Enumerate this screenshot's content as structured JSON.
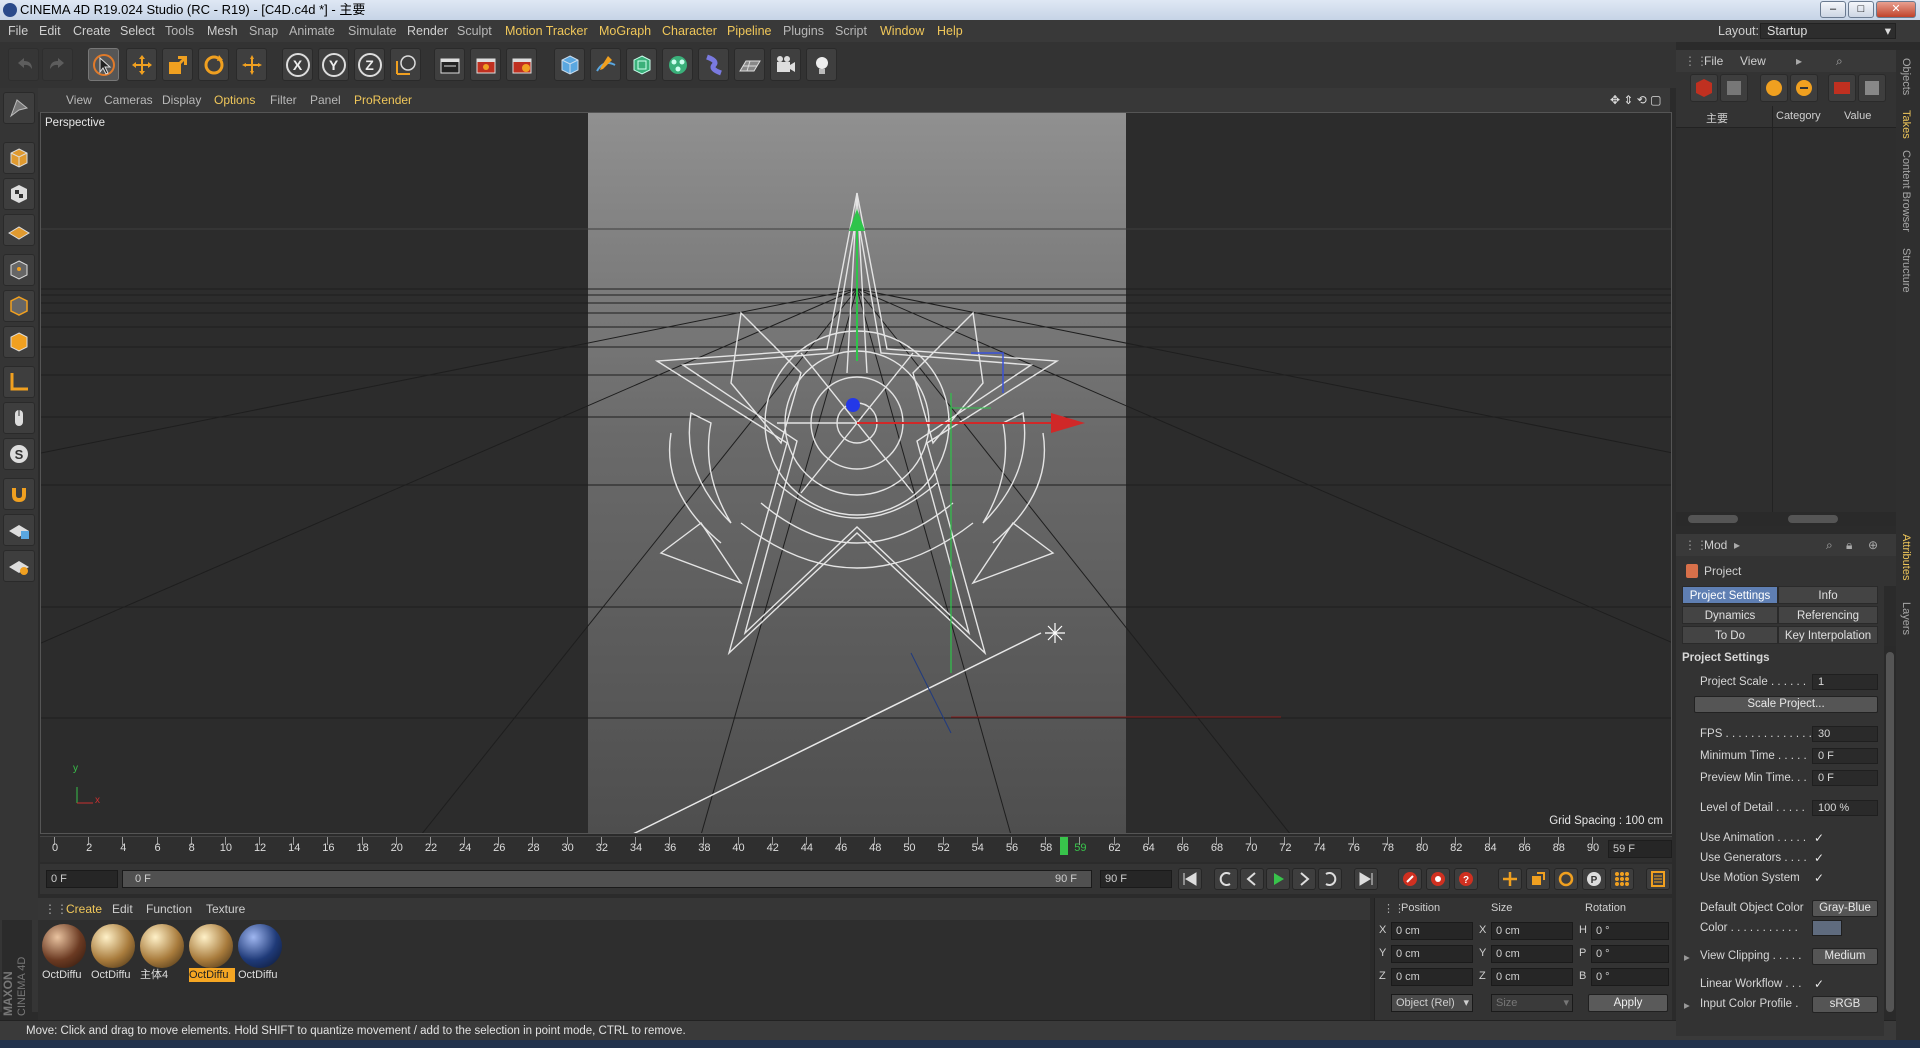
{
  "window": {
    "title": "CINEMA 4D R19.024 Studio (RC - R19) - [C4D.c4d *] - 主要"
  },
  "menu": [
    "File",
    "Edit",
    "Create",
    "Select",
    "Tools",
    "Mesh",
    "Snap",
    "Animate",
    "Simulate",
    "Render",
    "Sculpt",
    "Motion Tracker",
    "MoGraph",
    "Character",
    "Pipeline",
    "Plugins",
    "Script",
    "Window",
    "Help"
  ],
  "layout": {
    "label": "Layout:",
    "value": "Startup"
  },
  "toolbar": {
    "axes": [
      "X",
      "Y",
      "Z"
    ]
  },
  "viewport": {
    "menu": [
      "View",
      "Cameras",
      "Display",
      "Options",
      "Filter",
      "Panel",
      "ProRender"
    ],
    "camera_label": "Perspective",
    "grid_spacing": "Grid Spacing : 100 cm",
    "axis_y": "y",
    "axis_x": "x"
  },
  "timeline": {
    "ticks": [
      0,
      2,
      4,
      6,
      8,
      10,
      12,
      14,
      16,
      18,
      20,
      22,
      24,
      26,
      28,
      30,
      32,
      34,
      36,
      38,
      40,
      42,
      44,
      46,
      48,
      50,
      52,
      54,
      56,
      58,
      59,
      62,
      64,
      66,
      68,
      70,
      72,
      74,
      76,
      78,
      80,
      82,
      84,
      86,
      88,
      90
    ],
    "current_frame": 59,
    "frame_field": "59 F",
    "start_field": "0 F",
    "range_start": "0 F",
    "range_end": "90 F",
    "end_field": "90 F"
  },
  "materials": {
    "menu": [
      "Create",
      "Edit",
      "Function",
      "Texture"
    ],
    "items": [
      {
        "name": "OctDiffu",
        "color": "#6b3a22",
        "selected": false
      },
      {
        "name": "OctDiffu",
        "color": "#a87b3c",
        "selected": false
      },
      {
        "name": "主体4",
        "color": "#a87b3c",
        "selected": false
      },
      {
        "name": "OctDiffu",
        "color": "#a87b3c",
        "selected": true
      },
      {
        "name": "OctDiffu",
        "color": "#1f3a78",
        "selected": false
      }
    ]
  },
  "coordinates": {
    "headers": [
      "Position",
      "Size",
      "Rotation"
    ],
    "rows": [
      {
        "axis": "X",
        "pos": "0 cm",
        "size_axis": "X",
        "size": "0 cm",
        "rot_axis": "H",
        "rot": "0 °"
      },
      {
        "axis": "Y",
        "pos": "0 cm",
        "size_axis": "Y",
        "size": "0 cm",
        "rot_axis": "P",
        "rot": "0 °"
      },
      {
        "axis": "Z",
        "pos": "0 cm",
        "size_axis": "Z",
        "size": "0 cm",
        "rot_axis": "B",
        "rot": "0 °"
      }
    ],
    "mode": "Object (Rel)",
    "size_mode": "Size",
    "apply": "Apply"
  },
  "status": "Move: Click and drag to move elements. Hold SHIFT to quantize movement / add to the selection in point mode, CTRL to remove.",
  "objects": {
    "menu": [
      "File",
      "View"
    ],
    "columns": [
      "主要",
      "Category",
      "Value"
    ]
  },
  "attributes": {
    "menu": "Mod",
    "title": "Project",
    "tabs": [
      {
        "label": "Project Settings",
        "active": true
      },
      {
        "label": "Info",
        "active": false
      },
      {
        "label": "Dynamics",
        "active": false
      },
      {
        "label": "Referencing",
        "active": false
      },
      {
        "label": "To Do",
        "active": false
      },
      {
        "label": "Key Interpolation",
        "active": false
      }
    ],
    "section": "Project Settings",
    "project_scale_label": "Project Scale . . . . . .",
    "project_scale": "1",
    "scale_button": "Scale Project...",
    "fps_label": "FPS . . . . . . . . . . . . . .",
    "fps": "30",
    "min_time_label": "Minimum Time . . . . .",
    "min_time": "0 F",
    "preview_min_label": "Preview Min Time. . .",
    "preview_min": "0 F",
    "lod_label": "Level of Detail . . . . .",
    "lod": "100 %",
    "use_animation": "Use Animation . . . . .",
    "use_generators": "Use Generators . . . .",
    "use_motion": "Use Motion System",
    "default_color_label": "Default Object Color",
    "default_color": "Gray-Blue",
    "color_label": "Color . . . . . . . . . . .",
    "view_clipping_label": "View Clipping . . . . .",
    "view_clipping": "Medium",
    "linear_workflow": "Linear Workflow . . .",
    "input_profile_label": "Input Color Profile .",
    "input_profile": "sRGB"
  },
  "side_tabs": {
    "top": [
      "Objects",
      "Takes",
      "Content Browser",
      "Structure"
    ],
    "bottom": [
      "Attributes",
      "Layers"
    ]
  }
}
